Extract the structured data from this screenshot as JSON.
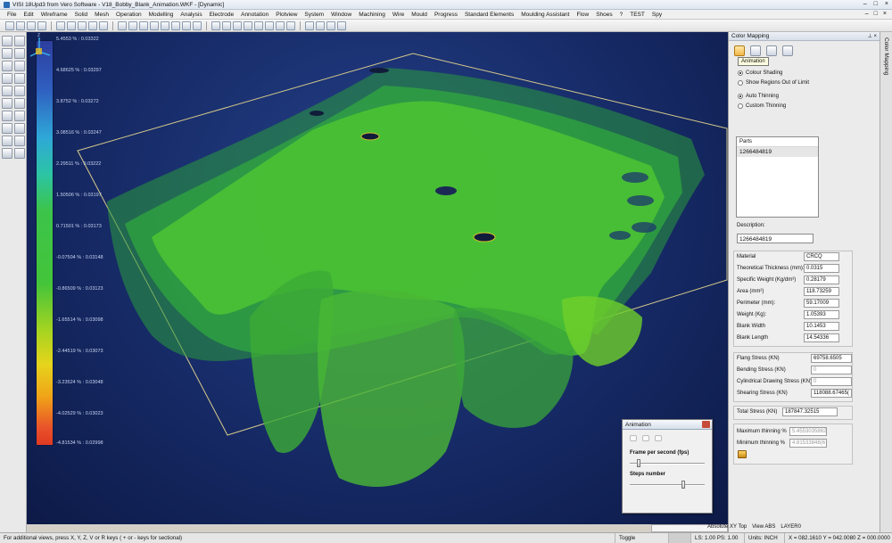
{
  "window": {
    "title": "VISI 18Upd3 from Vero Software - V18_Bobby_Blank_Animation.WKF - [Dynamic]",
    "controls": [
      "–",
      "□",
      "×"
    ]
  },
  "menu": [
    "File",
    "Edit",
    "Wireframe",
    "Solid",
    "Mesh",
    "Operation",
    "Modelling",
    "Analysis",
    "Electrode",
    "Annotation",
    "Plotview",
    "System",
    "Window",
    "Machining",
    "Wire",
    "Mould",
    "Progress",
    "Standard Elements",
    "Moulding Assistant",
    "Flow",
    "Shoes",
    "?",
    "TEST",
    "Spy"
  ],
  "scale": {
    "labels": [
      "5.4553 % : 0.03322",
      "4.68625 % : 0.03297",
      "3.8752 % : 0.03272",
      "3.08516 % : 0.03247",
      "2.29511 % : 0.03222",
      "1.50506 % : 0.03197",
      "0.71501 % : 0.03173",
      "-0.07504 % : 0.03148",
      "-0.86509 % : 0.03123",
      "-1.65514 % : 0.03098",
      "-2.44519 % : 0.03073",
      "-3.23524 % : 0.03048",
      "-4.02529 % : 0.03023",
      "-4.81534 % : 0.02998"
    ]
  },
  "axis": {
    "z": "Z",
    "y": "Y",
    "x": "X"
  },
  "animation_panel": {
    "title": "Animation",
    "fps_label": "Frame per second (fps)",
    "steps_label": "Steps number",
    "fps_value": 0.1,
    "steps_value": 0.72
  },
  "color_mapping": {
    "title": "Color Mapping",
    "tooltip": "Animation",
    "radio_shading": "Colour Shading",
    "radio_regions": "Show Regions Out of Limit",
    "radio_auto": "Auto Thinning",
    "radio_custom": "Custom Thinning",
    "parts_header": "Parts",
    "part_item": "1266484819",
    "description_label": "Description:",
    "description_value": "1266484819",
    "properties": [
      {
        "label": "Material",
        "value": "CRCQ"
      },
      {
        "label": "Theoretical Thickness (mm):",
        "value": "0.0315"
      },
      {
        "label": "Specific Weight (Kg/dm³)",
        "value": "0.28179"
      },
      {
        "label": "Area (mm²)",
        "value": "118.73259"
      },
      {
        "label": "Perimeter (mm):",
        "value": "59.17009"
      },
      {
        "label": "Weight (Kg):",
        "value": "1.05393"
      },
      {
        "label": "Blank Width",
        "value": "10.1453"
      },
      {
        "label": "Blank Length",
        "value": "14.54336"
      }
    ],
    "stresses": [
      {
        "label": "Flang Stress (KN)",
        "value": "69758.6505",
        "dim": false
      },
      {
        "label": "Bending Stress (KN)",
        "value": "0",
        "dim": true
      },
      {
        "label": "Cylindrical Drawing Stress (KN)",
        "value": "0",
        "dim": true
      },
      {
        "label": "Shearing Stress (KN)",
        "value": "118088.67465(",
        "dim": false
      }
    ],
    "total": {
      "label": "Total Stress (KN)",
      "value": "187847.32515"
    },
    "thinning": [
      {
        "label": "Maximum thinning %",
        "value": "5.45530358621"
      },
      {
        "label": "Minimum thinning %",
        "value": "4.81533848(6"
      }
    ]
  },
  "side_tab": "Color Mapping",
  "status": {
    "hint": "For additional views, press X, Y, Z, V or R keys ( + or - keys for sectional)",
    "toggle": "Toggle",
    "ls_ps": "LS: 1.00  PS: 1.00",
    "units": "Units: INCH",
    "coords": "X = 082.1610 Y = 042.0080 Z = 000.0000"
  },
  "view_tabs": {
    "absolute": "Absolute XY Top",
    "view": "View ABS",
    "layer": "LAYER0"
  }
}
